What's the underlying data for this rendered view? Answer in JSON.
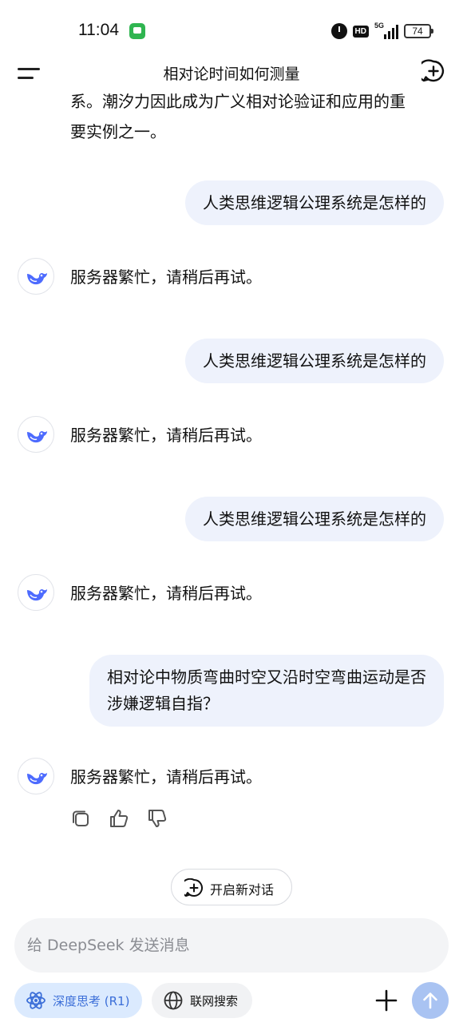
{
  "status_bar": {
    "time": "11:04",
    "hd": "HD",
    "network": "5G",
    "battery": "74"
  },
  "header": {
    "title": "相对论时间如何测量"
  },
  "chat": {
    "partial_line_1": "系。潮汐力因此成为广义相对论验证和应用的重",
    "partial_line_2": "要实例之一。",
    "user_messages": [
      "人类思维逻辑公理系统是怎样的",
      "人类思维逻辑公理系统是怎样的",
      "人类思维逻辑公理系统是怎样的",
      "相对论中物质弯曲时空又沿时空弯曲运动是否涉嫌逻辑自指？"
    ],
    "bot_messages": [
      "服务器繁忙，请稍后再试。",
      "服务器繁忙，请稍后再试。",
      "服务器繁忙，请稍后再试。",
      "服务器繁忙，请稍后再试。"
    ],
    "new_conversation_label": "开启新对话"
  },
  "input": {
    "placeholder": "给 DeepSeek 发送消息"
  },
  "toolbar": {
    "deep_think_label": "深度思考 (R1)",
    "web_search_label": "联网搜索"
  },
  "colors": {
    "user_bubble": "#eef2fc",
    "accent_blue": "#3b6ed8",
    "deep_think_bg": "#dbeafe",
    "send_button": "#a9c3f2",
    "whale": "#4d6bfe"
  },
  "icons": [
    "menu-icon",
    "new-chat-icon",
    "deepseek-whale-icon",
    "copy-icon",
    "thumbs-up-icon",
    "thumbs-down-icon",
    "atom-icon",
    "globe-icon",
    "plus-icon",
    "arrow-up-icon"
  ]
}
